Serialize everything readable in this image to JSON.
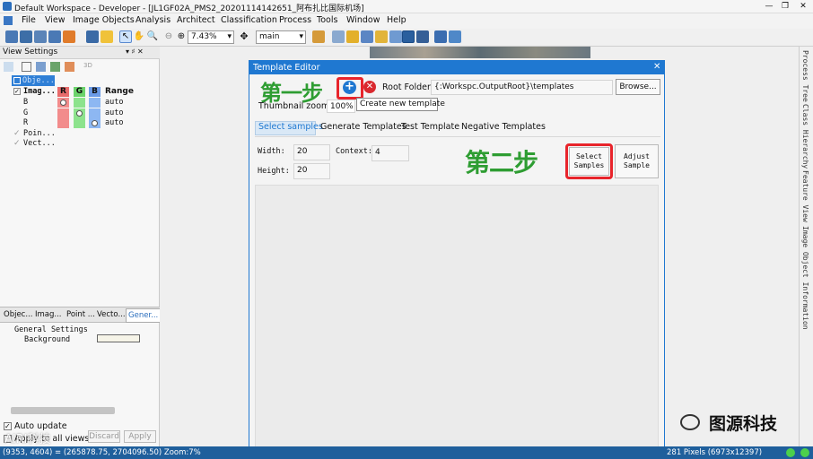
{
  "window": {
    "title": "Default Workspace - Developer - [JL1GF02A_PMS2_20201114142651_阿布扎比国际机场]",
    "controls": [
      "—",
      "❐",
      "✕"
    ]
  },
  "menu": [
    "File",
    "View",
    "Image Objects",
    "Analysis",
    "Architect",
    "Classification",
    "Process",
    "Tools",
    "Window",
    "Help"
  ],
  "toolbar": {
    "zoom_value": "7.43%",
    "view_value": "main"
  },
  "view_settings": {
    "title": "View Settings",
    "pin": "▾ ♯ ✕",
    "btn3d": "3D",
    "root_label": "Obje...",
    "image_label": "Imag...",
    "headers": {
      "r": "R",
      "g": "G",
      "b": "B",
      "range": "Range"
    },
    "rows": [
      {
        "name": "B",
        "range": "auto"
      },
      {
        "name": "G",
        "range": "auto"
      },
      {
        "name": "R",
        "range": "auto"
      }
    ],
    "points": "Poin...",
    "vectors": "Vect..."
  },
  "bottom_tabs": [
    "Objec...",
    "Imag...",
    "Point ...",
    "Vecto...",
    "Gener..."
  ],
  "general": {
    "header": "General Settings",
    "background": "Background"
  },
  "auto_update": "Auto update",
  "apply_all": "Apply to all views",
  "discard": "Discard",
  "apply": "Apply",
  "right_labels": [
    "Process Tree",
    "Class Hierarchy",
    "Feature View",
    "Image Object Information"
  ],
  "dialog": {
    "title": "Template Editor",
    "close": "✕",
    "root_folder_label": "Root Folder:",
    "root_folder_value": "{:Workspc.OutputRoot}\\templates",
    "browse": "Browse...",
    "thumb_label": "Thumbnail zoom:",
    "thumb_value": "100%",
    "tooltip": "Create new template",
    "tabs": [
      "Select samples",
      "Generate Templates",
      "Test Template",
      "Negative Templates"
    ],
    "width_label": "Width:",
    "width_value": "20",
    "height_label": "Height:",
    "height_value": "20",
    "context_label": "Context:",
    "context_value": "4",
    "select_samples": "Select Samples",
    "adjust_sample": "Adjust Sample"
  },
  "annotations": {
    "step1": "第一步",
    "step2": "第二步",
    "color": "#2e9d32",
    "highlight": "#e8242b"
  },
  "status": {
    "left": "(9353, 4604) = (265878.75, 2704096.50)  Zoom:7%",
    "right": "281 Pixels  (6973x12397)"
  },
  "watermark": {
    "text": "图源科技",
    "left_text": "AIRI科技"
  }
}
